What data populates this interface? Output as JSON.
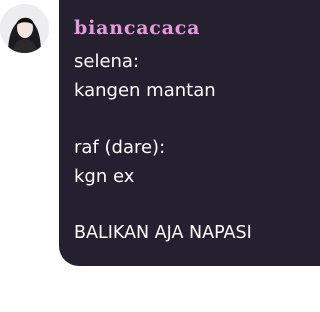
{
  "avatar": {
    "icon": "profile-photo"
  },
  "message": {
    "username": "biancacaca",
    "username_color": "#e89ad8",
    "bubble_color": "#24202f",
    "lines": [
      "selena:",
      "kangen mantan",
      "raf (dare):",
      "kgn ex",
      "BALIKAN AJA NAPASI"
    ]
  }
}
